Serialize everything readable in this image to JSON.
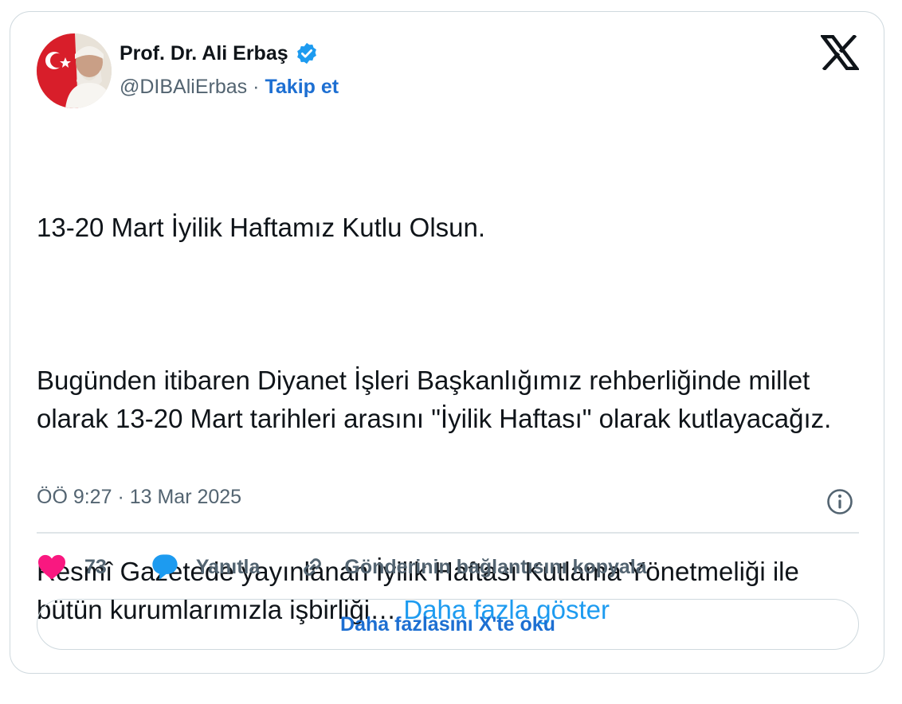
{
  "author": {
    "name": "Prof. Dr. Ali Erbaş",
    "handle": "@DIBAliErbas",
    "separator": "·",
    "follow_label": "Takip et",
    "verified": true
  },
  "tweet": {
    "paragraphs": [
      "13-20 Mart İyilik Haftamız Kutlu Olsun.",
      "Bugünden itibaren Diyanet İşleri Başkanlığımız rehberliğinde millet olarak 13-20 Mart tarihleri arasını \"İyilik Haftası\" olarak kutlayacağız.",
      "Resmî Gazetede yayınlanan İyilik Haftası Kutlama Yönetmeliği ile bütün kurumlarımızla işbirliği…"
    ],
    "show_more_label": "Daha fazla göster"
  },
  "meta": {
    "timestamp": "ÖÖ 9:27 · 13 Mar 2025"
  },
  "actions": {
    "like_count": "73",
    "reply_label": "Yanıtla",
    "copy_link_label": "Gönderinin bağlantısını kopyala"
  },
  "footer": {
    "read_more_label": "Daha fazlasını X'te oku"
  },
  "icons": {
    "verified": "verified-badge-icon",
    "logo": "x-logo-icon",
    "info": "info-icon",
    "like": "heart-icon",
    "reply": "speech-bubble-icon",
    "link": "link-icon"
  },
  "colors": {
    "accent_blue": "#1d9bf0",
    "link_blue": "#1d6fd2",
    "heart": "#f91880",
    "muted": "#536471",
    "border": "#cfd9de"
  }
}
